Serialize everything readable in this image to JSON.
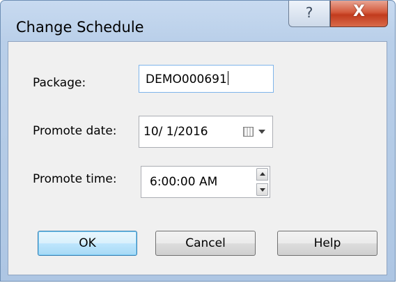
{
  "window": {
    "title": "Change Schedule",
    "help_glyph": "?",
    "close_glyph": "X"
  },
  "form": {
    "package_label": "Package:",
    "package_value": "DEMO000691",
    "promote_date_label": "Promote date:",
    "promote_date_value": "10/ 1/2016",
    "promote_time_label": "Promote time:",
    "promote_time_value": "6:00:00 AM"
  },
  "buttons": {
    "ok": "OK",
    "cancel": "Cancel",
    "help": "Help"
  },
  "icons": {
    "help": "question-mark-icon",
    "close": "close-icon",
    "calendar": "calendar-icon",
    "dropdown": "chevron-down-icon",
    "spin_up": "spin-up-icon",
    "spin_down": "spin-down-icon"
  },
  "colors": {
    "close_button": "#c9472a",
    "title_bar": "#b9cfe9",
    "client_background": "#f0f0f0",
    "default_button": "#bee6fd"
  }
}
